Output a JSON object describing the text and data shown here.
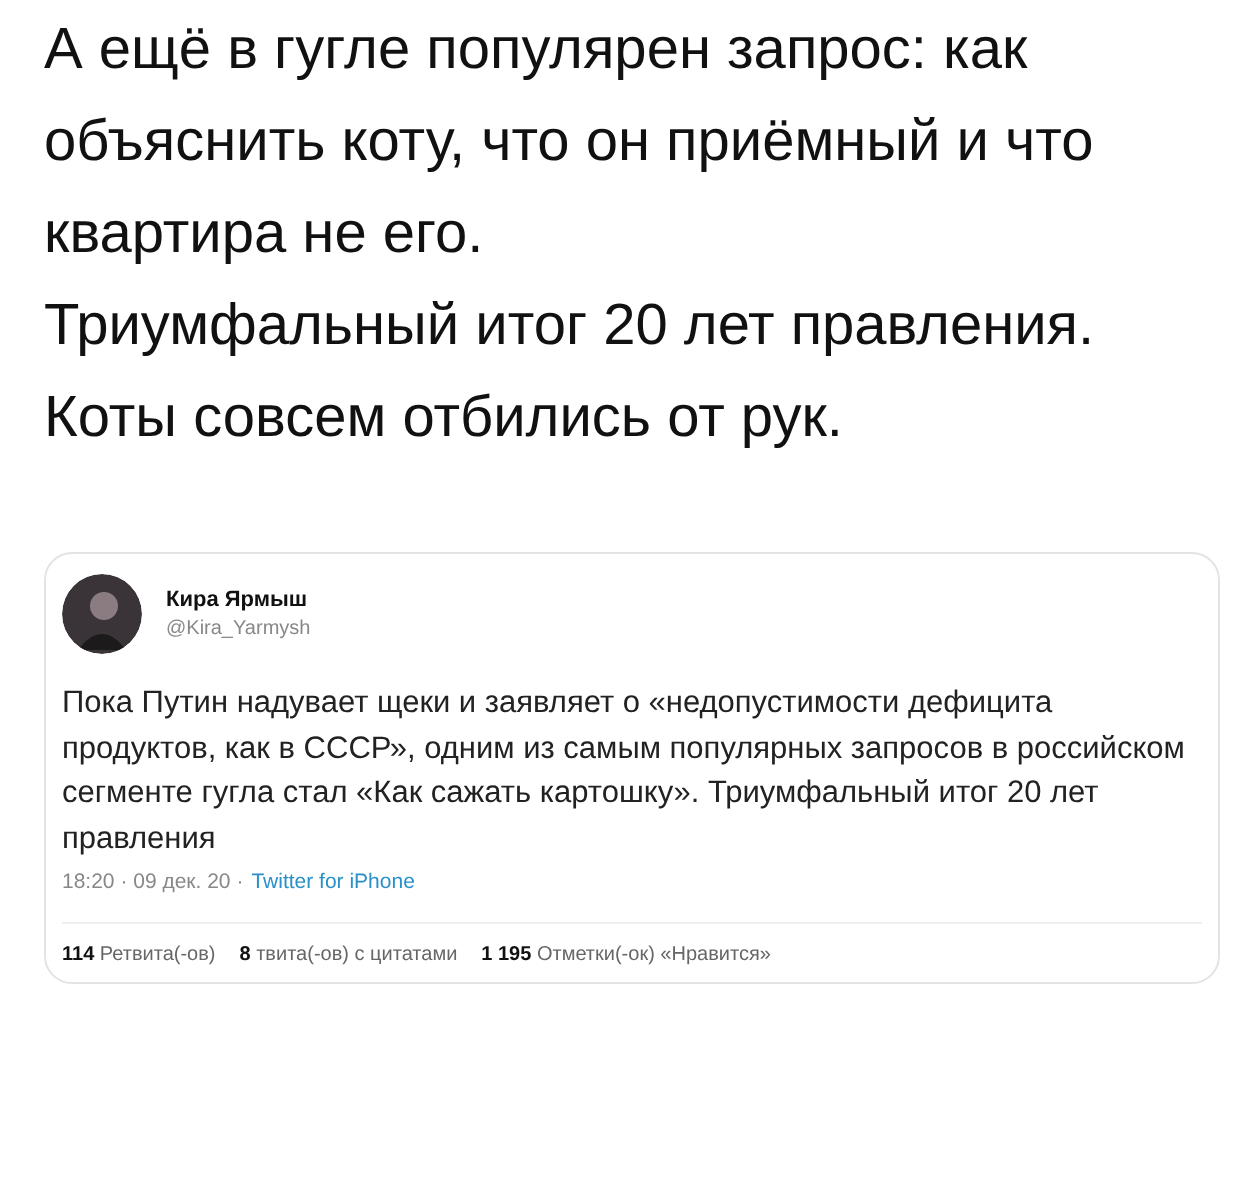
{
  "post": {
    "paragraphs": [
      "А ещё в гугле популярен запрос: как объяснить коту, что он приёмный и что квартира не его.",
      "Триумфальный итог 20 лет правления. Коты совсем отбились от рук."
    ]
  },
  "tweet": {
    "author": {
      "name": "Кира Ярмыш",
      "handle": "@Kira_Yarmysh"
    },
    "text": "Пока Путин надувает щеки и заявляет о «недопустимости дефицита продуктов, как в СССР», одним из самым популярных запросов в российском сегменте гугла стал «Как сажать картошку». Триумфальный итог 20 лет правления",
    "timestamp": "18:20 · 09 дек. 20 ·",
    "source": "Twitter for iPhone",
    "stats": [
      "**114** Ретвита(-ов)",
      "**8** твита(-ов) с цитатами",
      "**1 195** Отметки(-ок) «Нравится»"
    ]
  }
}
